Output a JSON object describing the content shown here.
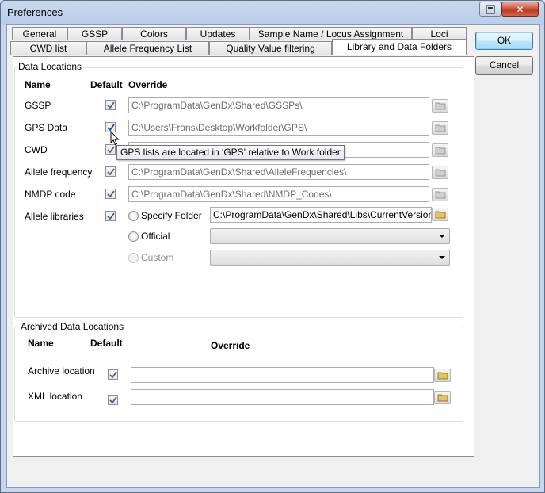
{
  "window": {
    "title": "Preferences"
  },
  "caption": {
    "close_label": "✕"
  },
  "tabs_row1": [
    {
      "label": "General"
    },
    {
      "label": "GSSP"
    },
    {
      "label": "Colors"
    },
    {
      "label": "Updates"
    },
    {
      "label": "Sample Name / Locus Assignment"
    },
    {
      "label": "Loci"
    }
  ],
  "tabs_row2": [
    {
      "label": "CWD list"
    },
    {
      "label": "Allele Frequency List"
    },
    {
      "label": "Quality Value filtering"
    },
    {
      "label": "Library and Data Folders",
      "active": true
    }
  ],
  "buttons": {
    "ok": "OK",
    "cancel": "Cancel"
  },
  "data_locations": {
    "group_label": "Data Locations",
    "headers": {
      "name": "Name",
      "default": "Default",
      "override": "Override"
    },
    "rows": [
      {
        "name": "GSSP",
        "default_checked": true,
        "override": "C:\\ProgramData\\GenDx\\Shared\\GSSPs\\"
      },
      {
        "name": "GPS Data",
        "default_checked": true,
        "override": "C:\\Users\\Frans\\Desktop\\Workfolder\\GPS\\"
      },
      {
        "name": "CWD",
        "default_checked": true,
        "override": ""
      },
      {
        "name": "Allele frequency",
        "default_checked": true,
        "override": "C:\\ProgramData\\GenDx\\Shared\\AlleleFrequencies\\"
      },
      {
        "name": "NMDP code",
        "default_checked": true,
        "override": "C:\\ProgramData\\GenDx\\Shared\\NMDP_Codes\\"
      }
    ],
    "allele_libraries": {
      "name": "Allele libraries",
      "default_checked": true,
      "specify_folder_label": "Specify Folder",
      "specify_folder_value": "C:\\ProgramData\\GenDx\\Shared\\Libs\\CurrentVersion\\",
      "official_label": "Official",
      "official_value": "",
      "custom_label": "Custom",
      "custom_value": ""
    },
    "tooltip": "GPS lists are located in 'GPS' relative to Work folder"
  },
  "archived_locations": {
    "group_label": "Archived Data Locations",
    "headers": {
      "name": "Name",
      "default": "Default",
      "override": "Override"
    },
    "rows": [
      {
        "name": "Archive location",
        "default_checked": true,
        "override": ""
      },
      {
        "name": "XML location",
        "default_checked": true,
        "override": ""
      }
    ]
  },
  "icons": {
    "checkmark": "checkmark-icon",
    "folder": "folder-icon",
    "dropdown": "chevron-down-icon",
    "cursor": "mouse-cursor-icon"
  },
  "colors": {
    "checkmark": "#4d6185",
    "folder": "#e5c365",
    "title_bar": "#b9cde9"
  }
}
